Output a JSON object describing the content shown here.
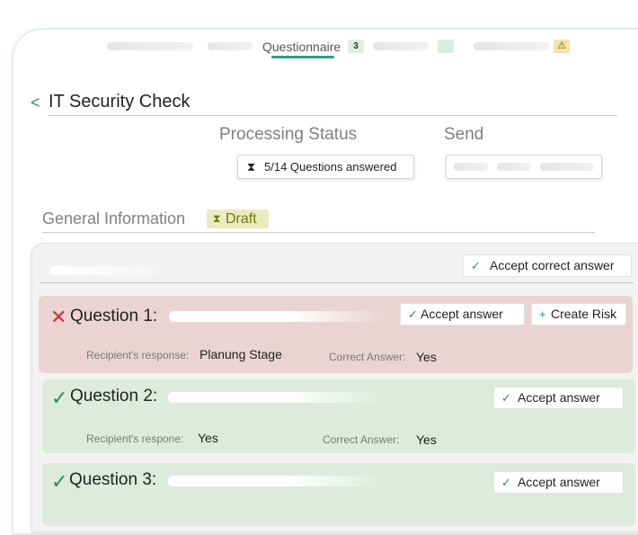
{
  "tabs": {
    "active_label": "Questionnaire",
    "active_count": "3",
    "warning_glyph": "⚠"
  },
  "header": {
    "back_glyph": "<",
    "title": "IT Security Check"
  },
  "processing": {
    "heading": "Processing Status",
    "icon": "⧗",
    "status_text": "5/14 Questions answered"
  },
  "send": {
    "heading": "Send"
  },
  "section": {
    "title": "General Information",
    "badge_icon": "⧗",
    "badge_label": "Draft"
  },
  "card": {
    "accept_all_icon": "✓",
    "accept_all_label": "Accept correct answer"
  },
  "questions": [
    {
      "status": "incorrect",
      "mark": "✕",
      "title": "Question 1:",
      "accept_icon": "✓",
      "accept_label": "Accept answer",
      "risk_icon": "+",
      "risk_label": "Create Risk",
      "response_key": "Recipient's response:",
      "response_value": "Planung Stage",
      "correct_key": "Correct Answer:",
      "correct_value": "Yes"
    },
    {
      "status": "correct",
      "mark": "✓",
      "title": "Question 2:",
      "accept_icon": "✓",
      "accept_label": "Accept answer",
      "response_key": "Recipient's respone:",
      "response_value": "Yes",
      "correct_key": "Correct Answer:",
      "correct_value": "Yes"
    },
    {
      "status": "correct",
      "mark": "✓",
      "title": "Question 3:",
      "accept_icon": "✓",
      "accept_label": "Accept answer"
    }
  ],
  "colors": {
    "accent": "#2e9f80",
    "incorrect_bg": "#ead3d3",
    "correct_bg": "#dcebdc",
    "draft_bg": "#eaecc0",
    "error": "#d43030"
  }
}
